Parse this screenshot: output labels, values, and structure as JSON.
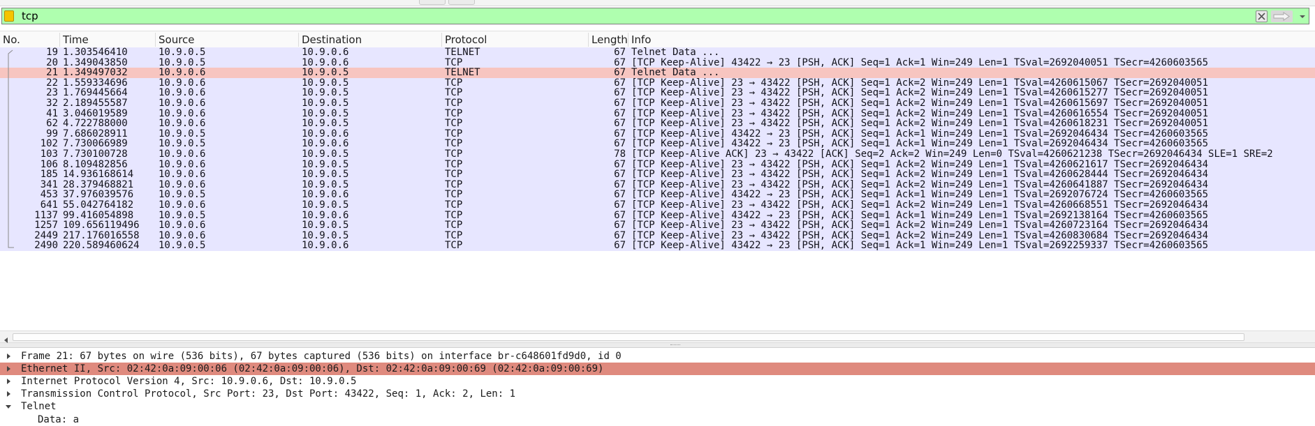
{
  "filter": {
    "value": "tcp"
  },
  "columns": [
    "No.",
    "Time",
    "Source",
    "Destination",
    "Protocol",
    "Length",
    "Info"
  ],
  "packets": [
    {
      "no": "19",
      "time": "1.303546410",
      "src": "10.9.0.5",
      "dst": "10.9.0.6",
      "proto": "TELNET",
      "len": "67",
      "info": "Telnet Data ..."
    },
    {
      "no": "20",
      "time": "1.349043850",
      "src": "10.9.0.5",
      "dst": "10.9.0.6",
      "proto": "TCP",
      "len": "67",
      "info": "[TCP Keep-Alive] 43422 → 23 [PSH, ACK] Seq=1 Ack=1 Win=249 Len=1 TSval=2692040051 TSecr=4260603565"
    },
    {
      "no": "21",
      "time": "1.349497032",
      "src": "10.9.0.6",
      "dst": "10.9.0.5",
      "proto": "TELNET",
      "len": "67",
      "info": "Telnet Data ..."
    },
    {
      "no": "22",
      "time": "1.559334696",
      "src": "10.9.0.6",
      "dst": "10.9.0.5",
      "proto": "TCP",
      "len": "67",
      "info": "[TCP Keep-Alive] 23 → 43422 [PSH, ACK] Seq=1 Ack=2 Win=249 Len=1 TSval=4260615067 TSecr=2692040051"
    },
    {
      "no": "23",
      "time": "1.769445664",
      "src": "10.9.0.6",
      "dst": "10.9.0.5",
      "proto": "TCP",
      "len": "67",
      "info": "[TCP Keep-Alive] 23 → 43422 [PSH, ACK] Seq=1 Ack=2 Win=249 Len=1 TSval=4260615277 TSecr=2692040051"
    },
    {
      "no": "32",
      "time": "2.189455587",
      "src": "10.9.0.6",
      "dst": "10.9.0.5",
      "proto": "TCP",
      "len": "67",
      "info": "[TCP Keep-Alive] 23 → 43422 [PSH, ACK] Seq=1 Ack=2 Win=249 Len=1 TSval=4260615697 TSecr=2692040051"
    },
    {
      "no": "41",
      "time": "3.046019589",
      "src": "10.9.0.6",
      "dst": "10.9.0.5",
      "proto": "TCP",
      "len": "67",
      "info": "[TCP Keep-Alive] 23 → 43422 [PSH, ACK] Seq=1 Ack=2 Win=249 Len=1 TSval=4260616554 TSecr=2692040051"
    },
    {
      "no": "62",
      "time": "4.722788000",
      "src": "10.9.0.6",
      "dst": "10.9.0.5",
      "proto": "TCP",
      "len": "67",
      "info": "[TCP Keep-Alive] 23 → 43422 [PSH, ACK] Seq=1 Ack=2 Win=249 Len=1 TSval=4260618231 TSecr=2692040051"
    },
    {
      "no": "99",
      "time": "7.686028911",
      "src": "10.9.0.5",
      "dst": "10.9.0.6",
      "proto": "TCP",
      "len": "67",
      "info": "[TCP Keep-Alive] 43422 → 23 [PSH, ACK] Seq=1 Ack=1 Win=249 Len=1 TSval=2692046434 TSecr=4260603565"
    },
    {
      "no": "102",
      "time": "7.730066989",
      "src": "10.9.0.5",
      "dst": "10.9.0.6",
      "proto": "TCP",
      "len": "67",
      "info": "[TCP Keep-Alive] 43422 → 23 [PSH, ACK] Seq=1 Ack=1 Win=249 Len=1 TSval=2692046434 TSecr=4260603565"
    },
    {
      "no": "103",
      "time": "7.730100728",
      "src": "10.9.0.6",
      "dst": "10.9.0.5",
      "proto": "TCP",
      "len": "78",
      "info": "[TCP Keep-Alive ACK] 23 → 43422 [ACK] Seq=2 Ack=2 Win=249 Len=0 TSval=4260621238 TSecr=2692046434 SLE=1 SRE=2"
    },
    {
      "no": "106",
      "time": "8.109482856",
      "src": "10.9.0.6",
      "dst": "10.9.0.5",
      "proto": "TCP",
      "len": "67",
      "info": "[TCP Keep-Alive] 23 → 43422 [PSH, ACK] Seq=1 Ack=2 Win=249 Len=1 TSval=4260621617 TSecr=2692046434"
    },
    {
      "no": "185",
      "time": "14.936168614",
      "src": "10.9.0.6",
      "dst": "10.9.0.5",
      "proto": "TCP",
      "len": "67",
      "info": "[TCP Keep-Alive] 23 → 43422 [PSH, ACK] Seq=1 Ack=2 Win=249 Len=1 TSval=4260628444 TSecr=2692046434"
    },
    {
      "no": "341",
      "time": "28.379468821",
      "src": "10.9.0.6",
      "dst": "10.9.0.5",
      "proto": "TCP",
      "len": "67",
      "info": "[TCP Keep-Alive] 23 → 43422 [PSH, ACK] Seq=1 Ack=2 Win=249 Len=1 TSval=4260641887 TSecr=2692046434"
    },
    {
      "no": "453",
      "time": "37.976039576",
      "src": "10.9.0.5",
      "dst": "10.9.0.6",
      "proto": "TCP",
      "len": "67",
      "info": "[TCP Keep-Alive] 43422 → 23 [PSH, ACK] Seq=1 Ack=1 Win=249 Len=1 TSval=2692076724 TSecr=4260603565"
    },
    {
      "no": "641",
      "time": "55.042764182",
      "src": "10.9.0.6",
      "dst": "10.9.0.5",
      "proto": "TCP",
      "len": "67",
      "info": "[TCP Keep-Alive] 23 → 43422 [PSH, ACK] Seq=1 Ack=2 Win=249 Len=1 TSval=4260668551 TSecr=2692046434"
    },
    {
      "no": "1137",
      "time": "99.416054898",
      "src": "10.9.0.5",
      "dst": "10.9.0.6",
      "proto": "TCP",
      "len": "67",
      "info": "[TCP Keep-Alive] 43422 → 23 [PSH, ACK] Seq=1 Ack=1 Win=249 Len=1 TSval=2692138164 TSecr=4260603565"
    },
    {
      "no": "1257",
      "time": "109.656119496",
      "src": "10.9.0.6",
      "dst": "10.9.0.5",
      "proto": "TCP",
      "len": "67",
      "info": "[TCP Keep-Alive] 23 → 43422 [PSH, ACK] Seq=1 Ack=2 Win=249 Len=1 TSval=4260723164 TSecr=2692046434"
    },
    {
      "no": "2449",
      "time": "217.176016558",
      "src": "10.9.0.6",
      "dst": "10.9.0.5",
      "proto": "TCP",
      "len": "67",
      "info": "[TCP Keep-Alive] 23 → 43422 [PSH, ACK] Seq=1 Ack=2 Win=249 Len=1 TSval=4260830684 TSecr=2692046434"
    },
    {
      "no": "2490",
      "time": "220.589460624",
      "src": "10.9.0.5",
      "dst": "10.9.0.6",
      "proto": "TCP",
      "len": "67",
      "info": "[TCP Keep-Alive] 43422 → 23 [PSH, ACK] Seq=1 Ack=1 Win=249 Len=1 TSval=2692259337 TSecr=4260603565"
    }
  ],
  "selected_packet_no": "21",
  "details": [
    {
      "text": "Frame 21: 67 bytes on wire (536 bits), 67 bytes captured (536 bits) on interface br-c648601fd9d0, id 0",
      "expander": "collapsed"
    },
    {
      "text": "Ethernet II, Src: 02:42:0a:09:00:06 (02:42:0a:09:00:06), Dst: 02:42:0a:09:00:69 (02:42:0a:09:00:69)",
      "expander": "collapsed",
      "selected": true
    },
    {
      "text": "Internet Protocol Version 4, Src: 10.9.0.6, Dst: 10.9.0.5",
      "expander": "collapsed"
    },
    {
      "text": "Transmission Control Protocol, Src Port: 23, Dst Port: 43422, Seq: 1, Ack: 2, Len: 1",
      "expander": "collapsed"
    },
    {
      "text": "Telnet",
      "expander": "expanded"
    },
    {
      "text": "Data: a",
      "expander": "none",
      "child": true
    }
  ],
  "colors": {
    "filter_valid": "#afffaf",
    "row_tcp": "#e7e6ff",
    "row_selected": "#f7c5c0",
    "detail_selected": "#df8a7e"
  },
  "icons": {
    "bookmark": "bookmark-icon",
    "clear": "clear-filter-icon",
    "apply": "apply-filter-arrow-icon",
    "history": "chevron-down-icon"
  }
}
